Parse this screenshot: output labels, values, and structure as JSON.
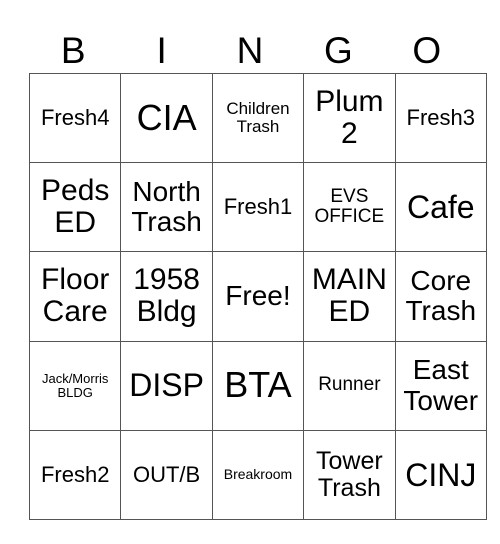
{
  "header": {
    "letters": [
      "B",
      "I",
      "N",
      "G",
      "O"
    ]
  },
  "card": {
    "rows": [
      [
        "Fresh4",
        "CIA",
        "Children Trash",
        "Plum 2",
        "Fresh3"
      ],
      [
        "Peds ED",
        "North Trash",
        "Fresh1",
        "EVS OFFICE",
        "Cafe"
      ],
      [
        "Floor Care",
        "1958 Bldg",
        "Free!",
        "MAIN ED",
        "Core Trash"
      ],
      [
        "Jack/Morris BLDG",
        "DISP",
        "BTA",
        "Runner",
        "East Tower"
      ],
      [
        "Fresh2",
        "OUT/B",
        "Breakroom",
        "Tower Trash",
        "CINJ"
      ]
    ],
    "free_space": "Free!"
  },
  "colors": {
    "grid_line": "#555555",
    "text": "#000000",
    "background": "#ffffff"
  }
}
